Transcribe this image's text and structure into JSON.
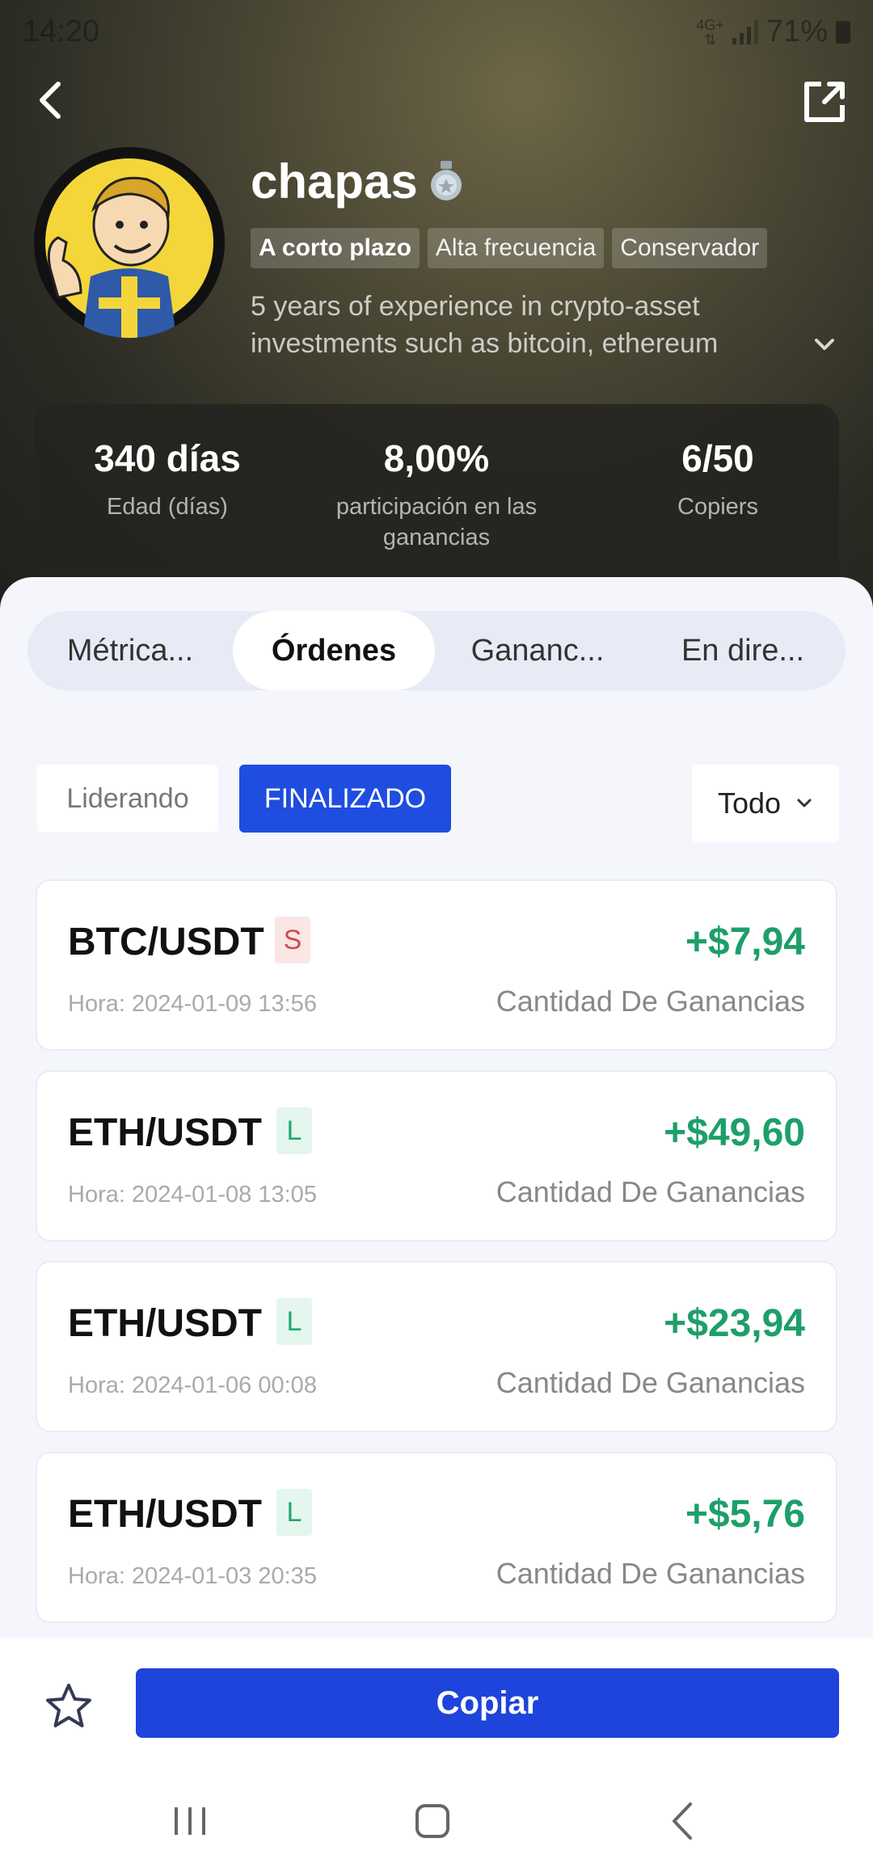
{
  "status_bar": {
    "time": "14:20",
    "network": "4G+",
    "battery": "71%"
  },
  "profile": {
    "name": "chapas",
    "tags": [
      "A corto plazo",
      "Alta frecuencia",
      "Conservador"
    ],
    "bio": "5 years of experience in crypto-asset investments such as bitcoin, ethereum"
  },
  "stats": [
    {
      "value": "340 días",
      "label": "Edad (días)"
    },
    {
      "value": "8,00%",
      "label": "participación en las ganancias"
    },
    {
      "value": "6/50",
      "label": "Copiers"
    }
  ],
  "tabs": [
    "Métrica...",
    "Órdenes",
    "Gananc...",
    "En dire..."
  ],
  "segments": {
    "leading": "Liderando",
    "finished": "FINALIZADO"
  },
  "filter": {
    "selected": "Todo"
  },
  "orders": [
    {
      "pair": "BTC/USDT",
      "side": "S",
      "pnl": "+$7,94",
      "time": "Hora: 2024-01-09 13:56",
      "pnl_label": "Cantidad De Ganancias"
    },
    {
      "pair": "ETH/USDT",
      "side": "L",
      "pnl": "+$49,60",
      "time": "Hora: 2024-01-08 13:05",
      "pnl_label": "Cantidad De Ganancias"
    },
    {
      "pair": "ETH/USDT",
      "side": "L",
      "pnl": "+$23,94",
      "time": "Hora: 2024-01-06 00:08",
      "pnl_label": "Cantidad De Ganancias"
    },
    {
      "pair": "ETH/USDT",
      "side": "L",
      "pnl": "+$5,76",
      "time": "Hora: 2024-01-03 20:35",
      "pnl_label": "Cantidad De Ganancias"
    }
  ],
  "actions": {
    "copy": "Copiar"
  },
  "colors": {
    "accent": "#1e44dc",
    "profit": "#1d9f6a",
    "short": "#d24a4a",
    "long": "#1faa6e"
  }
}
